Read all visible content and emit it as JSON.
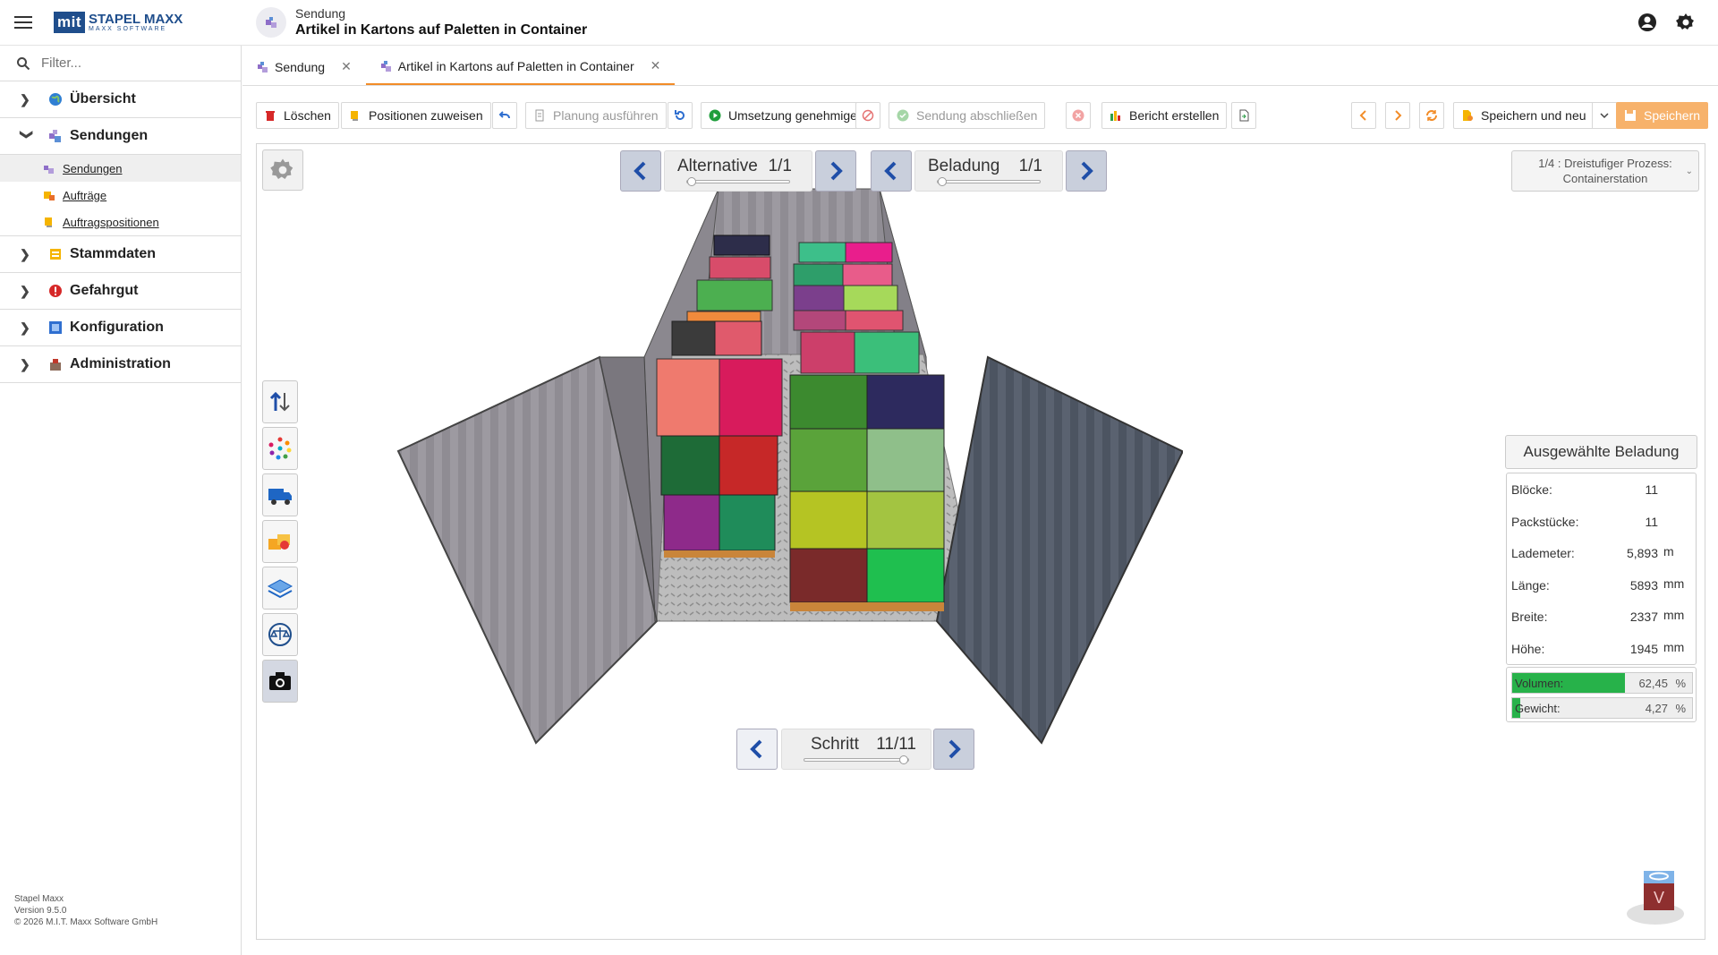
{
  "app": {
    "brand_short": "mit",
    "brand_name": "STAPEL MAXX",
    "brand_sub": "MAXX SOFTWARE"
  },
  "header": {
    "breadcrumb": "Sendung",
    "title": "Artikel in Kartons auf Paletten in Container"
  },
  "sidebar": {
    "filter_placeholder": "Filter...",
    "items": [
      {
        "label": "Übersicht",
        "icon": "globe-icon"
      },
      {
        "label": "Sendungen",
        "icon": "shipment-icon",
        "expanded": true,
        "children": [
          {
            "label": "Sendungen",
            "active": true
          },
          {
            "label": "Aufträge"
          },
          {
            "label": "Auftragspositionen"
          }
        ]
      },
      {
        "label": "Stammdaten",
        "icon": "masterdata-icon"
      },
      {
        "label": "Gefahrgut",
        "icon": "hazard-icon"
      },
      {
        "label": "Konfiguration",
        "icon": "config-icon"
      },
      {
        "label": "Administration",
        "icon": "admin-icon"
      }
    ],
    "footer": {
      "product": "Stapel Maxx",
      "version": "Version 9.5.0",
      "copyright": "© 2026 M.I.T. Maxx Software GmbH"
    }
  },
  "tabs": [
    {
      "label": "Sendung",
      "active": false
    },
    {
      "label": "Artikel in Kartons auf Paletten in Container",
      "active": true
    }
  ],
  "toolbar": {
    "delete": "Löschen",
    "assign": "Positionen zuweisen",
    "run_planning": "Planung ausführen",
    "approve": "Umsetzung genehmigen",
    "complete": "Sendung abschließen",
    "report": "Bericht erstellen",
    "save_new": "Speichern und neu",
    "save": "Speichern"
  },
  "viewer": {
    "alternative": {
      "label": "Alternative",
      "value": "1/1",
      "progress": 0
    },
    "loading": {
      "label": "Beladung",
      "value": "1/1",
      "progress": 0
    },
    "step": {
      "label": "Schritt",
      "value": "11/11",
      "progress": 1
    },
    "process": {
      "line1": "1/4 : Dreistufiger Prozess:",
      "line2": "Containerstation"
    },
    "tools": [
      "sort-arrows-icon",
      "color-dots-icon",
      "truck-icon",
      "boxes-icon",
      "layers-icon",
      "scale-icon",
      "camera-icon"
    ]
  },
  "info": {
    "title": "Ausgewählte Beladung",
    "rows": [
      {
        "label": "Blöcke:",
        "value": "11",
        "unit": ""
      },
      {
        "label": "Packstücke:",
        "value": "11",
        "unit": ""
      },
      {
        "label": "Lademeter:",
        "value": "5,893",
        "unit": "m"
      },
      {
        "label": "Länge:",
        "value": "5893",
        "unit": "mm"
      },
      {
        "label": "Breite:",
        "value": "2337",
        "unit": "mm"
      },
      {
        "label": "Höhe:",
        "value": "1945",
        "unit": "mm"
      }
    ],
    "volume": {
      "label": "Volumen:",
      "value": "62,45",
      "unit": "%",
      "fraction": 0.6245
    },
    "weight": {
      "label": "Gewicht:",
      "value": "4,27",
      "unit": "%",
      "fraction": 0.0427
    }
  },
  "orient_cube_label": "V",
  "colors": {
    "accent": "#f28c28",
    "brand": "#1f4e8c",
    "progress": "#27b24a",
    "wall": "#8c8a90",
    "wall_dark": "#4d5563",
    "floor": "#b9b9b9"
  }
}
